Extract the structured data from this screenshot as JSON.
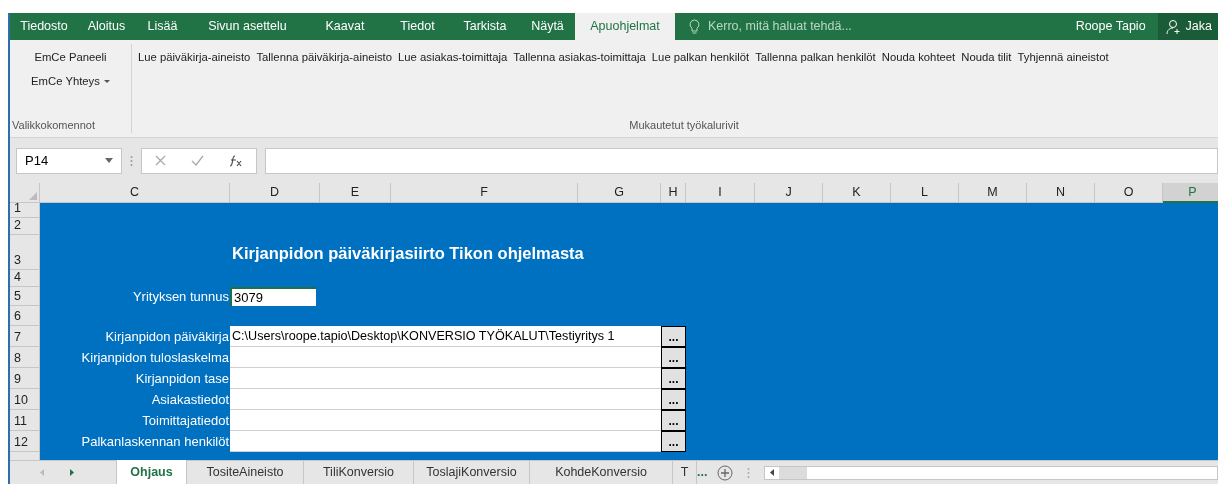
{
  "ribbon_tabs": [
    {
      "label": "Tiedosto",
      "selected": false
    },
    {
      "label": "Aloitus",
      "selected": false
    },
    {
      "label": "Lisää",
      "selected": false
    },
    {
      "label": "Sivun asettelu",
      "selected": false
    },
    {
      "label": "Kaavat",
      "selected": false
    },
    {
      "label": "Tiedot",
      "selected": false
    },
    {
      "label": "Tarkista",
      "selected": false
    },
    {
      "label": "Näytä",
      "selected": false
    },
    {
      "label": "Apuohjelmat",
      "selected": true
    }
  ],
  "tell_me": {
    "placeholder": "Kerro, mitä haluat tehdä..."
  },
  "user": "Roope Tapio",
  "share": "Jaka",
  "ribbon_groups": [
    {
      "label": "Valikkokomennot",
      "items": [
        {
          "label": "EmCe Paneeli",
          "kind": "button"
        },
        {
          "label": "EmCe Yhteys",
          "kind": "dropdown"
        }
      ]
    },
    {
      "label": "Mukautetut työkalurivit",
      "items": [
        {
          "label": "Lue päiväkirja-aineisto",
          "kind": "button"
        },
        {
          "label": "Tallenna päiväkirja-aineisto",
          "kind": "button"
        },
        {
          "label": "Lue asiakas-toimittaja",
          "kind": "button"
        },
        {
          "label": "Tallenna asiakas-toimittaja",
          "kind": "button"
        },
        {
          "label": "Lue palkan henkilöt",
          "kind": "button"
        },
        {
          "label": "Tallenna palkan henkilöt",
          "kind": "button"
        },
        {
          "label": "Nouda kohteet",
          "kind": "button"
        },
        {
          "label": "Nouda tilit",
          "kind": "button"
        },
        {
          "label": "Tyhjennä aineistot",
          "kind": "button"
        }
      ]
    }
  ],
  "name_box": "P14",
  "columns": [
    {
      "label": "C",
      "selected": false
    },
    {
      "label": "D",
      "selected": false
    },
    {
      "label": "E",
      "selected": false
    },
    {
      "label": "F",
      "selected": false
    },
    {
      "label": "G",
      "selected": false
    },
    {
      "label": "H",
      "selected": false
    },
    {
      "label": "I",
      "selected": false
    },
    {
      "label": "J",
      "selected": false
    },
    {
      "label": "K",
      "selected": false
    },
    {
      "label": "L",
      "selected": false
    },
    {
      "label": "M",
      "selected": false
    },
    {
      "label": "N",
      "selected": false
    },
    {
      "label": "O",
      "selected": false
    },
    {
      "label": "P",
      "selected": true
    }
  ],
  "row_numbers": [
    "1",
    "2",
    "3",
    "4",
    "5",
    "6",
    "7",
    "8",
    "9",
    "10",
    "11",
    "12"
  ],
  "sheet": {
    "title": "Kirjanpidon päiväkirjasiirto Tikon ohjelmasta",
    "company": {
      "label": "Yrityksen tunnus",
      "value": "3079"
    },
    "files": [
      {
        "label": "Kirjanpidon päiväkirja",
        "value": "C:\\Users\\roope.tapio\\Desktop\\KONVERSIO TYÖKALUT\\Testiyritys 1",
        "button": "..."
      },
      {
        "label": "Kirjanpidon tuloslaskelma",
        "button": "..."
      },
      {
        "label": "Kirjanpidon tase",
        "button": "..."
      },
      {
        "label": "Asiakastiedot",
        "button": "..."
      },
      {
        "label": "Toimittajatiedot",
        "button": "..."
      },
      {
        "label": "Palkanlaskennan henkilöt",
        "button": "..."
      }
    ]
  },
  "sheet_tabs": [
    {
      "label": "Ohjaus",
      "selected": true
    },
    {
      "label": "TositeAineisto",
      "selected": false
    },
    {
      "label": "TiliKonversio",
      "selected": false
    },
    {
      "label": "ToslajiKonversio",
      "selected": false
    },
    {
      "label": "KohdeKonversio",
      "selected": false
    },
    {
      "label": "T",
      "selected": false
    }
  ],
  "more_tabs": "..."
}
